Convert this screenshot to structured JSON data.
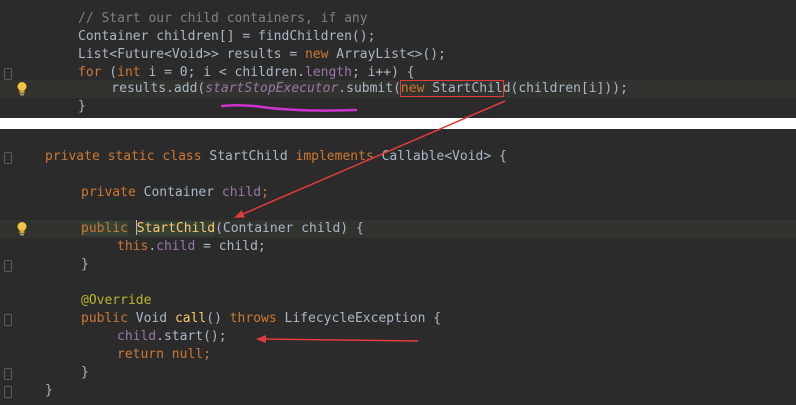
{
  "top_panel": {
    "lines": [
      {
        "parts": [
          {
            "t": "// Start our child containers, if any",
            "c": "comment"
          }
        ]
      },
      {
        "parts": [
          {
            "t": "Container children[] = findChildren();",
            "c": ""
          }
        ]
      },
      {
        "parts": [
          {
            "t": "List<Future<Void>> results = ",
            "c": ""
          },
          {
            "t": "new",
            "c": "kw"
          },
          {
            "t": " ArrayList<>();",
            "c": ""
          }
        ]
      },
      {
        "parts": [
          {
            "t": "for",
            "c": "kw"
          },
          {
            "t": " (",
            "c": ""
          },
          {
            "t": "int",
            "c": "kw"
          },
          {
            "t": " i = ",
            "c": ""
          },
          {
            "t": "0",
            "c": "num"
          },
          {
            "t": "; i < children.",
            "c": ""
          },
          {
            "t": "length",
            "c": "field"
          },
          {
            "t": "; i++) {",
            "c": ""
          }
        ]
      },
      {
        "parts": [
          {
            "t": "    results.add(",
            "c": ""
          },
          {
            "t": "startStopExecutor",
            "c": "field"
          },
          {
            "t": ".submit(",
            "c": ""
          },
          {
            "t": "new",
            "c": "kw"
          },
          {
            "t": " StartChild(children[i]));",
            "c": ""
          }
        ]
      },
      {
        "parts": [
          {
            "t": "}",
            "c": ""
          }
        ]
      }
    ]
  },
  "bottom_panel": {
    "class_decl": {
      "kw1": "private",
      "kw2": "static",
      "kw3": "class",
      "name": "StartChild",
      "kw4": "implements",
      "rest": "Callable<Void> {"
    },
    "field_decl": {
      "kw": "private",
      "type": "Container",
      "name": "child",
      "end": ";"
    },
    "ctor": {
      "kw": "public",
      "name": "StartChild",
      "params": "(Container child) {"
    },
    "ctor_body": {
      "this": "this",
      "dot": ".",
      "field": "child",
      "rest": " = child;"
    },
    "close1": "}",
    "annotation": "@Override",
    "method_sig": {
      "kw": "public",
      "type": " Void ",
      "name": "call",
      "paren": "() ",
      "throws": "throws",
      "rest": " LifecycleException {"
    },
    "stmt1": {
      "field": "child",
      "rest": ".start();"
    },
    "stmt2": {
      "kw": "return",
      "sp": " ",
      "null": "null",
      "end": ";"
    },
    "close2": "}",
    "close3": "}"
  },
  "colors": {
    "background": "#2b2b2b",
    "keyword": "#cc7832",
    "comment": "#808080",
    "field": "#9876aa",
    "annotation_marker": "#cc33cc",
    "arrow": "#e23b3b"
  }
}
